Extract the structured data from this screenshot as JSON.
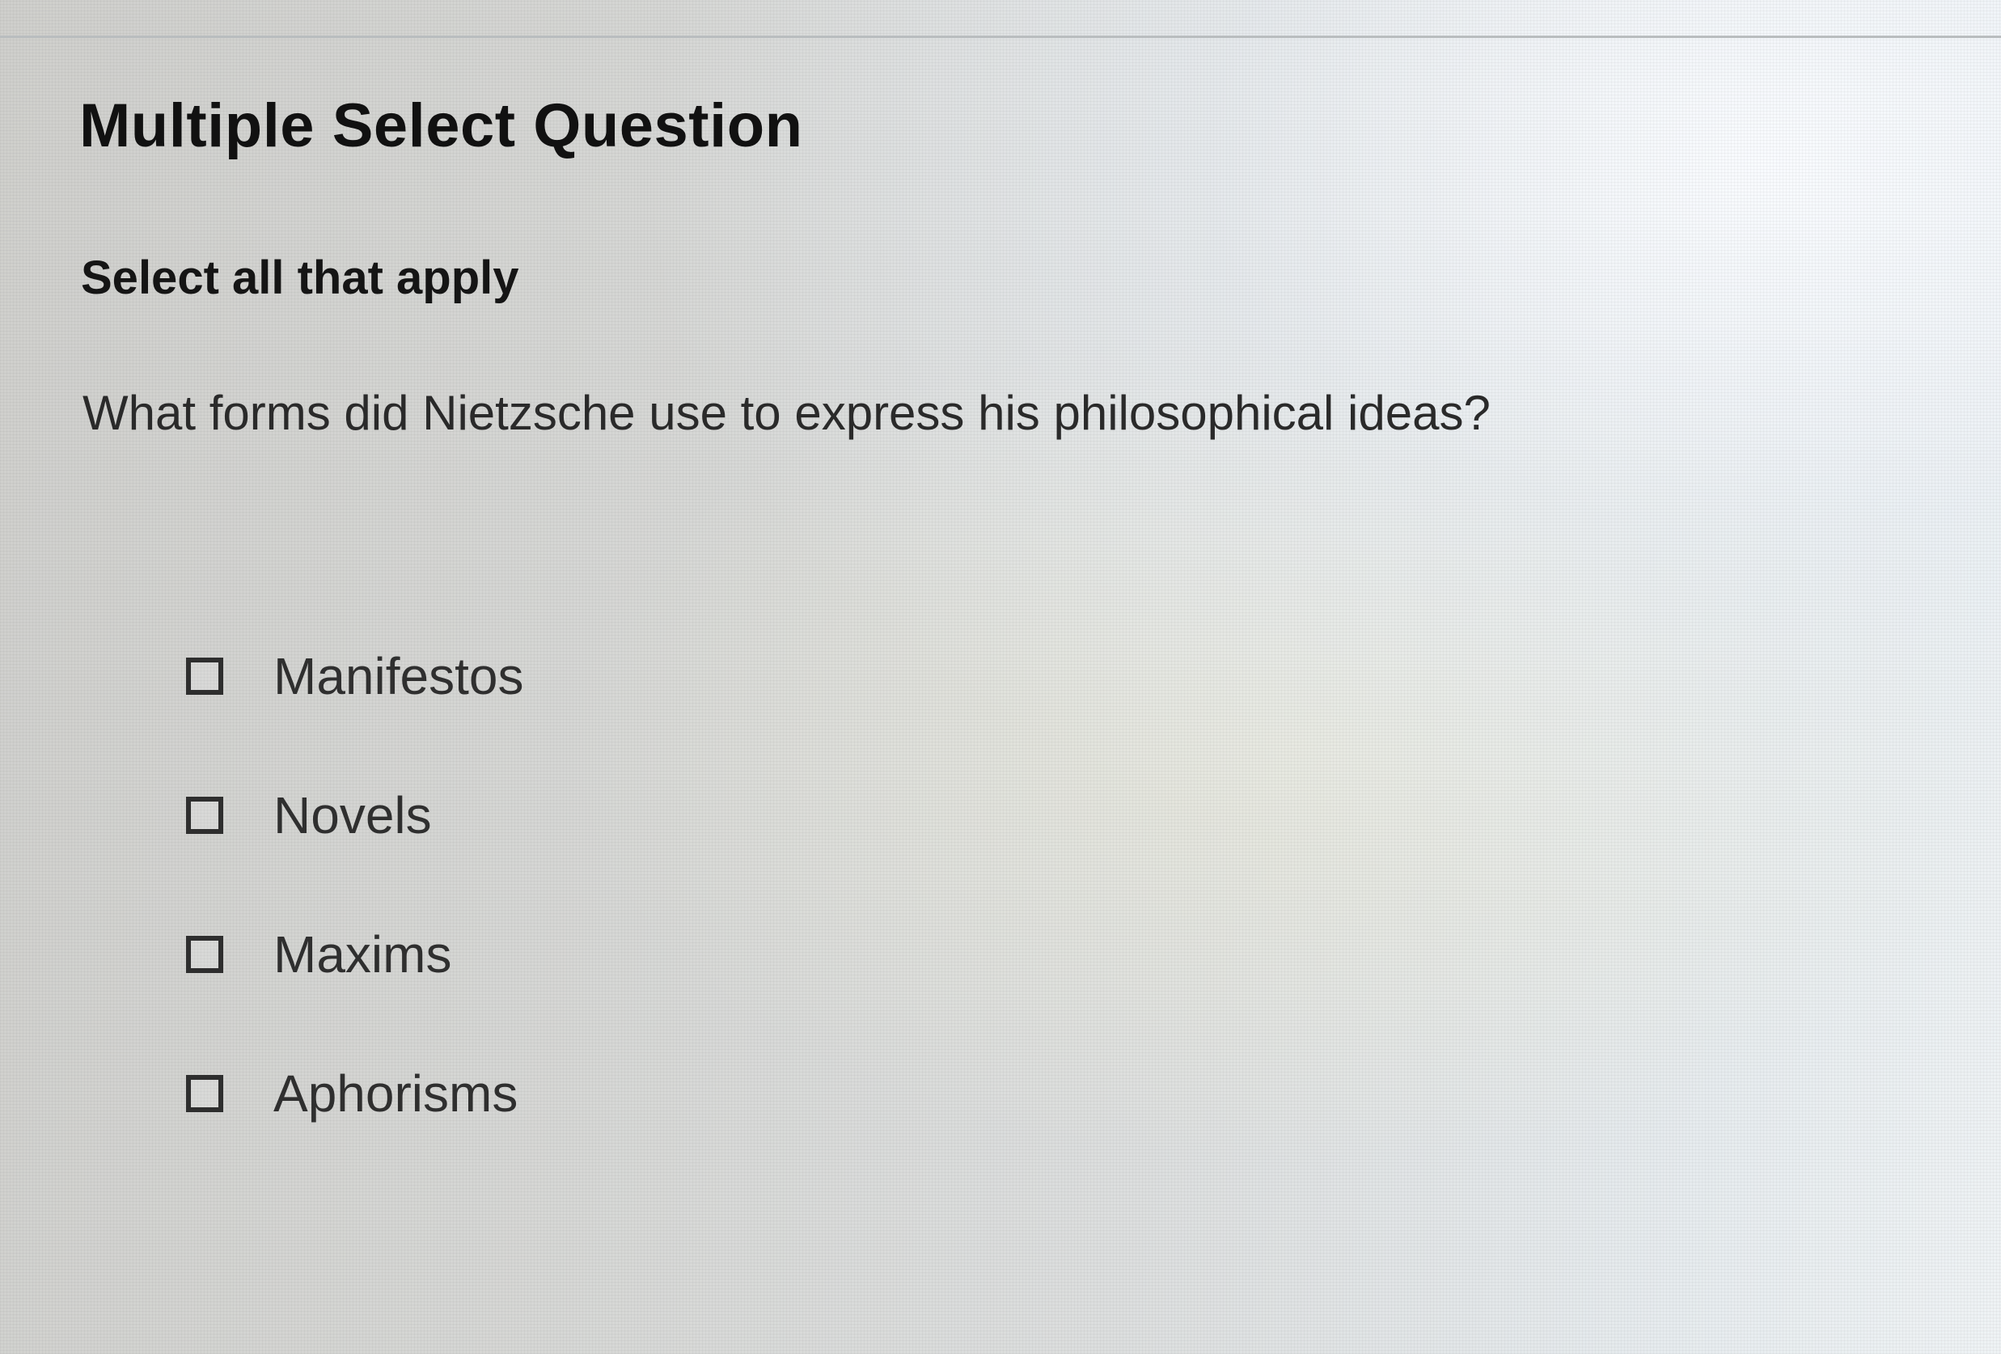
{
  "question": {
    "type_label": "Multiple Select Question",
    "instruction": "Select all that apply",
    "prompt": "What forms did Nietzsche use to express his philosophical ideas?"
  },
  "options": [
    {
      "label": "Manifestos",
      "checked": false
    },
    {
      "label": "Novels",
      "checked": false
    },
    {
      "label": "Maxims",
      "checked": false
    },
    {
      "label": "Aphorisms",
      "checked": false
    }
  ]
}
